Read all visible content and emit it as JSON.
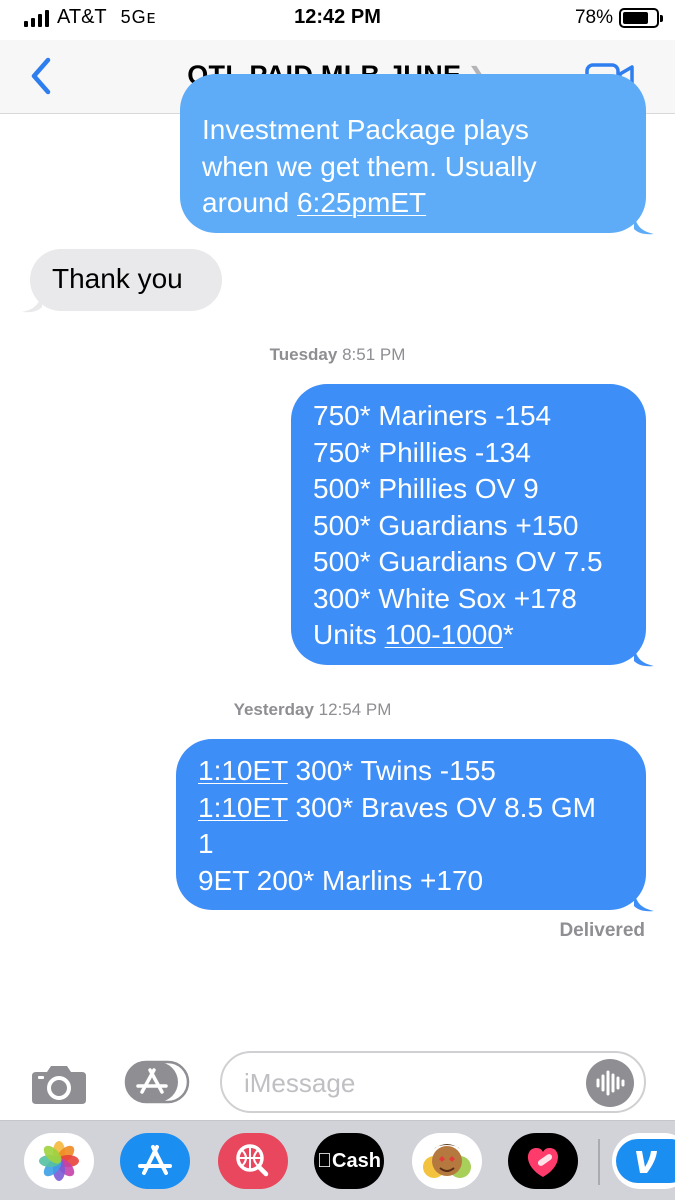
{
  "status_bar": {
    "carrier": "AT&T",
    "network": "5Gᴇ",
    "time": "12:42 PM",
    "battery_percent": "78%",
    "battery_level": 0.78
  },
  "header": {
    "title": "OTL PAID MLB JUNE"
  },
  "messages": {
    "msg1_lines": [
      "Investment Package plays",
      "when we get them. Usually"
    ],
    "msg1_last_prefix": "around ",
    "msg1_last_link": "6:25pmET",
    "msg2_text": "Thank you",
    "ts1_day": "Tuesday",
    "ts1_time": "8:51 PM",
    "msg3_lines": [
      "750* Mariners -154",
      "750* Phillies -134",
      "500* Phillies OV 9",
      "500* Guardians +150",
      "500* Guardians OV 7.5",
      "300* White Sox +178"
    ],
    "msg3_last_prefix": "Units ",
    "msg3_last_link": "100-1000",
    "msg3_last_suffix": "*",
    "ts2_day": "Yesterday",
    "ts2_time": "12:54 PM",
    "msg4_l1_link": "1:10ET",
    "msg4_l1_rest": " 300* Twins -155",
    "msg4_l2_link": "1:10ET",
    "msg4_l2_rest": " 300* Braves OV 8.5 GM",
    "msg4_l3": "1",
    "msg4_l4": "9ET 200* Marlins +170",
    "delivered": "Delivered"
  },
  "input_bar": {
    "placeholder": "iMessage"
  },
  "app_drawer": {
    "cash_label": "Cash",
    "icons": [
      "photos-icon",
      "app-store-icon",
      "web-search-icon",
      "apple-cash-icon",
      "memoji-stickers-icon",
      "fitness-heart-icon",
      "venmo-icon"
    ]
  }
}
